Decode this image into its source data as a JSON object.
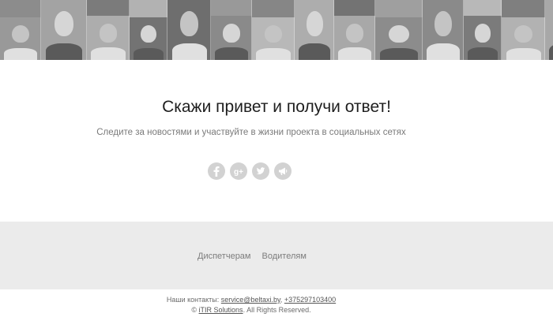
{
  "hero": {
    "title": "Скажи привет и получи ответ!",
    "subtitle": "Следите за новостями и участвуйте в жизни проекта в социальных сетях"
  },
  "social": [
    {
      "icon": "facebook-icon",
      "glyph": "f"
    },
    {
      "icon": "google-plus-icon",
      "glyph": "g+"
    },
    {
      "icon": "twitter-icon",
      "glyph": "bird"
    },
    {
      "icon": "megaphone-icon",
      "glyph": "speaker"
    }
  ],
  "footer": {
    "nav": [
      "Диспетчерам",
      "Водителям"
    ],
    "contacts_label": "Наши контакты:",
    "email": "service@beltaxi.by",
    "separator": ",",
    "phone": "+375297103400",
    "copyright_symbol": "©",
    "company": "iTIR Solutions",
    "rights": ". All Rights Reserved."
  },
  "colors": {
    "footer_bg": "#ebebeb",
    "social_icon_bg": "#d2d2d2"
  }
}
